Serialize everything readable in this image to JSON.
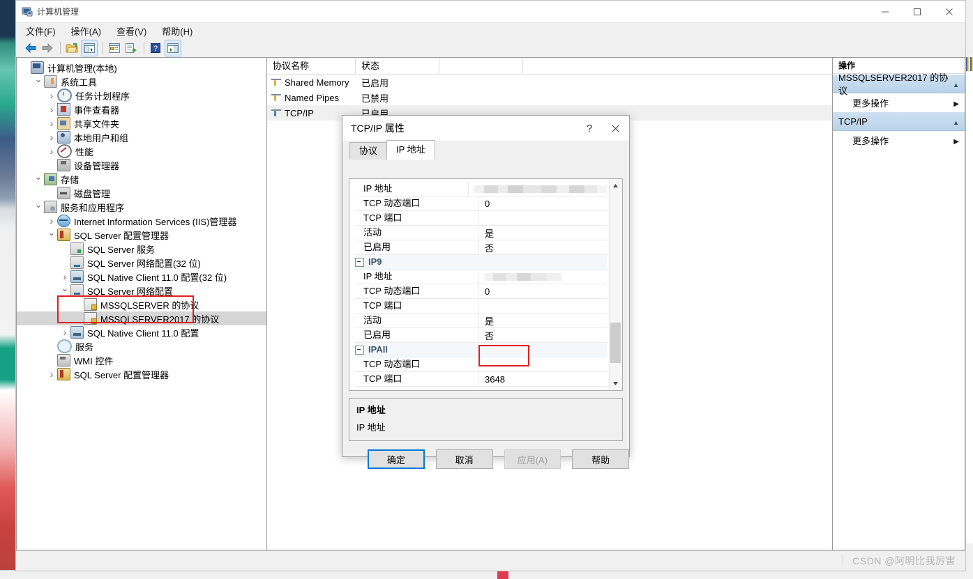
{
  "window": {
    "title": "计算机管理",
    "icon": "computer-management-icon",
    "controls": {
      "minimize": "—",
      "maximize": "▢",
      "close": "✕"
    },
    "menu": [
      "文件(F)",
      "操作(A)",
      "查看(V)",
      "帮助(H)"
    ],
    "toolbar_icons": [
      "back-arrow-icon",
      "forward-arrow-icon",
      "open-folder-icon",
      "show-tree-pane-icon",
      "properties-icon",
      "export-list-icon",
      "help-icon",
      "show-action-pane-icon"
    ]
  },
  "tree": {
    "items": [
      {
        "label": "计算机管理(本地)",
        "indent": 0,
        "chev": "none",
        "icon": "computer-icon",
        "selected": false
      },
      {
        "label": "系统工具",
        "indent": 1,
        "chev": "open",
        "icon": "tools-icon",
        "selected": false
      },
      {
        "label": "任务计划程序",
        "indent": 2,
        "chev": "closed",
        "icon": "clock-icon",
        "selected": false
      },
      {
        "label": "事件查看器",
        "indent": 2,
        "chev": "closed",
        "icon": "event-viewer-icon",
        "selected": false
      },
      {
        "label": "共享文件夹",
        "indent": 2,
        "chev": "closed",
        "icon": "shared-folder-icon",
        "selected": false
      },
      {
        "label": "本地用户和组",
        "indent": 2,
        "chev": "closed",
        "icon": "users-group-icon",
        "selected": false
      },
      {
        "label": "性能",
        "indent": 2,
        "chev": "closed",
        "icon": "performance-icon",
        "selected": false
      },
      {
        "label": "设备管理器",
        "indent": 2,
        "chev": "none",
        "icon": "device-manager-icon",
        "selected": false
      },
      {
        "label": "存储",
        "indent": 1,
        "chev": "open",
        "icon": "storage-icon",
        "selected": false
      },
      {
        "label": "磁盘管理",
        "indent": 2,
        "chev": "none",
        "icon": "disk-management-icon",
        "selected": false
      },
      {
        "label": "服务和应用程序",
        "indent": 1,
        "chev": "open",
        "icon": "services-apps-icon",
        "selected": false
      },
      {
        "label": "Internet Information Services (IIS)管理器",
        "indent": 2,
        "chev": "closed",
        "icon": "iis-icon",
        "selected": false
      },
      {
        "label": "SQL Server 配置管理器",
        "indent": 2,
        "chev": "open",
        "icon": "sql-config-icon",
        "selected": false
      },
      {
        "label": "SQL Server 服务",
        "indent": 3,
        "chev": "none",
        "icon": "sql-service-icon",
        "selected": false
      },
      {
        "label": "SQL Server 网络配置(32 位)",
        "indent": 3,
        "chev": "none",
        "icon": "sql-network-icon",
        "selected": false
      },
      {
        "label": "SQL Native Client 11.0 配置(32 位)",
        "indent": 3,
        "chev": "closed",
        "icon": "sql-client-icon",
        "selected": false
      },
      {
        "label": "SQL Server 网络配置",
        "indent": 3,
        "chev": "open",
        "icon": "sql-network-icon",
        "selected": false
      },
      {
        "label": "MSSQLSERVER 的协议",
        "indent": 4,
        "chev": "none",
        "icon": "protocols-icon",
        "selected": false
      },
      {
        "label": "MSSQLSERVER2017 的协议",
        "indent": 4,
        "chev": "none",
        "icon": "protocols-icon",
        "selected": true
      },
      {
        "label": "SQL Native Client 11.0 配置",
        "indent": 3,
        "chev": "closed",
        "icon": "sql-client-icon",
        "selected": false
      },
      {
        "label": "服务",
        "indent": 2,
        "chev": "none",
        "icon": "service-gear-icon",
        "selected": false
      },
      {
        "label": "WMI 控件",
        "indent": 2,
        "chev": "none",
        "icon": "wmi-icon",
        "selected": false
      },
      {
        "label": "SQL Server 配置管理器",
        "indent": 2,
        "chev": "closed",
        "icon": "sql-config-icon",
        "selected": false
      }
    ],
    "highlight_color": "#e02020"
  },
  "list": {
    "columns": [
      "协议名称",
      "状态"
    ],
    "rows": [
      {
        "name": "Shared Memory",
        "state": "已启用",
        "selected": false
      },
      {
        "name": "Named Pipes",
        "state": "已禁用",
        "selected": false
      },
      {
        "name": "TCP/IP",
        "state": "已启用",
        "selected": true
      }
    ]
  },
  "actions": {
    "header": "操作",
    "groups": [
      {
        "title": "MSSQLSERVER2017 的协议",
        "items": [
          "更多操作"
        ]
      },
      {
        "title": "TCP/IP",
        "items": [
          "更多操作"
        ]
      }
    ]
  },
  "dialog": {
    "title": "TCP/IP 属性",
    "help_glyph": "?",
    "close_glyph": "✕",
    "tabs": [
      {
        "label": "协议",
        "active": false
      },
      {
        "label": "IP 地址",
        "active": true
      }
    ],
    "grid_rows": [
      {
        "type": "row",
        "name": "IP 地址",
        "value": "",
        "blurred": "long"
      },
      {
        "type": "row",
        "name": "TCP 动态端口",
        "value": "0",
        "blurred": ""
      },
      {
        "type": "row",
        "name": "TCP 端口",
        "value": "",
        "blurred": ""
      },
      {
        "type": "row",
        "name": "活动",
        "value": "是",
        "blurred": ""
      },
      {
        "type": "row",
        "name": "已启用",
        "value": "否",
        "blurred": ""
      },
      {
        "type": "group",
        "name": "IP9",
        "value": "",
        "blurred": ""
      },
      {
        "type": "row",
        "name": "IP 地址",
        "value": "",
        "blurred": "short"
      },
      {
        "type": "row",
        "name": "TCP 动态端口",
        "value": "0",
        "blurred": ""
      },
      {
        "type": "row",
        "name": "TCP 端口",
        "value": "",
        "blurred": ""
      },
      {
        "type": "row",
        "name": "活动",
        "value": "是",
        "blurred": ""
      },
      {
        "type": "row",
        "name": "已启用",
        "value": "否",
        "blurred": ""
      },
      {
        "type": "group",
        "name": "IPAll",
        "value": "",
        "blurred": ""
      },
      {
        "type": "row",
        "name": "TCP 动态端口",
        "value": "",
        "blurred": ""
      },
      {
        "type": "row",
        "name": "TCP 端口",
        "value": "3648",
        "blurred": "",
        "highlighted": true
      }
    ],
    "highlight_color": "#e02020",
    "description": {
      "title": "IP 地址",
      "text": "IP 地址"
    },
    "buttons": [
      {
        "label": "确定",
        "style": "primary"
      },
      {
        "label": "取消",
        "style": "normal"
      },
      {
        "label": "应用(A)",
        "style": "disabled"
      },
      {
        "label": "帮助",
        "style": "normal"
      }
    ]
  },
  "watermark": "CSDN @阿明比我厉害"
}
